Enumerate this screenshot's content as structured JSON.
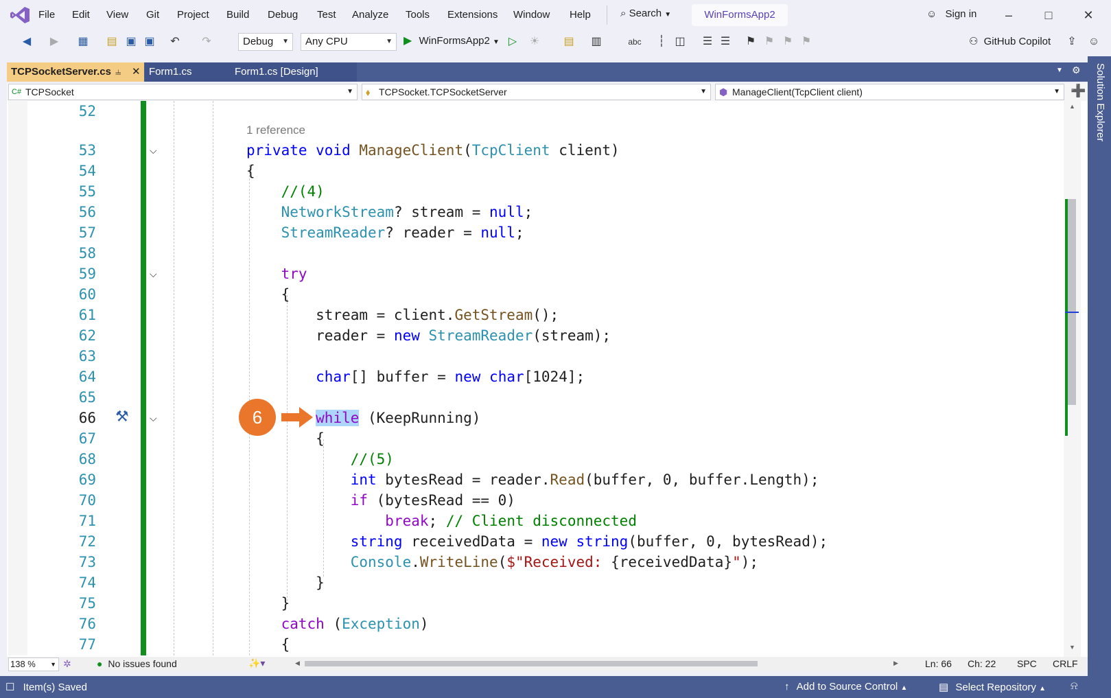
{
  "menubar": {
    "items": [
      "File",
      "Edit",
      "View",
      "Git",
      "Project",
      "Build",
      "Debug",
      "Test",
      "Analyze",
      "Tools",
      "Extensions",
      "Window",
      "Help"
    ],
    "search_label": "Search",
    "project_name": "WinFormsApp2",
    "signin_label": "Sign in"
  },
  "toolbar": {
    "config_value": "Debug",
    "platform_value": "Any CPU",
    "start_label": "WinFormsApp2",
    "copilot_label": "GitHub Copilot"
  },
  "tabs": [
    {
      "label": "TCPSocketServer.cs",
      "active": true
    },
    {
      "label": "Form1.cs",
      "active": false
    },
    {
      "label": "Form1.cs [Design]",
      "active": false
    }
  ],
  "navbar": {
    "project": "TCPSocket",
    "type": "TCPSocket.TCPSocketServer",
    "member": "ManageClient(TcpClient client)"
  },
  "editor": {
    "reference_text": "1 reference",
    "annotation_number": "6",
    "line_numbers": [
      "52",
      "53",
      "54",
      "55",
      "56",
      "57",
      "58",
      "59",
      "60",
      "61",
      "62",
      "63",
      "64",
      "65",
      "66",
      "67",
      "68",
      "69",
      "70",
      "71",
      "72",
      "73",
      "74",
      "75",
      "76",
      "77"
    ],
    "current_line": "66"
  },
  "status_editor": {
    "zoom": "138 %",
    "issues": "No issues found",
    "line": "Ln: 66",
    "col": "Ch: 22",
    "spacing": "SPC",
    "eol": "CRLF"
  },
  "statusbar": {
    "message": "Item(s) Saved",
    "source_control": "Add to Source Control",
    "repository": "Select Repository"
  },
  "side_panel": {
    "label": "Solution Explorer"
  },
  "colors": {
    "accent": "#4A5D93",
    "tab_active": "#F5CC84",
    "annotation": "#E9762B",
    "changebar": "#108F1F"
  }
}
